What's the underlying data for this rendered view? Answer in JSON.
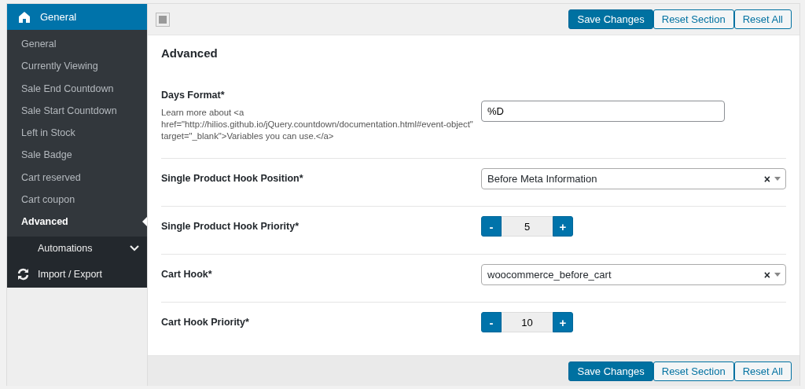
{
  "sidebar": {
    "header": {
      "label": "General"
    },
    "items": [
      {
        "label": "General",
        "selected": false
      },
      {
        "label": "Currently Viewing",
        "selected": false
      },
      {
        "label": "Sale End Countdown",
        "selected": false
      },
      {
        "label": "Sale Start Countdown",
        "selected": false
      },
      {
        "label": "Left in Stock",
        "selected": false
      },
      {
        "label": "Sale Badge",
        "selected": false
      },
      {
        "label": "Cart reserved",
        "selected": false
      },
      {
        "label": "Cart coupon",
        "selected": false
      },
      {
        "label": "Advanced",
        "selected": true
      }
    ],
    "groups": [
      {
        "kind": "collapsible",
        "label": "Automations",
        "expanded": false
      },
      {
        "kind": "link",
        "label": "Import / Export"
      }
    ]
  },
  "toolbar": {
    "buttons": [
      {
        "label": "Save Changes",
        "kind": "primary"
      },
      {
        "label": "Reset Section",
        "kind": "secondary"
      },
      {
        "label": "Reset All",
        "kind": "secondary"
      }
    ]
  },
  "section": {
    "title": "Advanced",
    "fields": [
      {
        "kind": "text",
        "label": "Days Format*",
        "description": "Learn more about <a href=\"http://hilios.github.io/jQuery.countdown/documentation.html#event-object\" target=\"_blank\">Variables you can use.</a>",
        "value": "%D"
      },
      {
        "kind": "select",
        "label": "Single Product Hook Position*",
        "value": "Before Meta Information",
        "clear": "×"
      },
      {
        "kind": "spinner",
        "label": "Single Product Hook Priority*",
        "value": "5",
        "minus": "-",
        "plus": "+"
      },
      {
        "kind": "select",
        "label": "Cart Hook*",
        "value": "woocommerce_before_cart",
        "clear": "×"
      },
      {
        "kind": "spinner",
        "label": "Cart Hook Priority*",
        "value": "10",
        "minus": "-",
        "plus": "+"
      }
    ]
  },
  "footer": {
    "buttons": [
      {
        "label": "Save Changes",
        "kind": "primary"
      },
      {
        "label": "Reset Section",
        "kind": "secondary"
      },
      {
        "label": "Reset All",
        "kind": "secondary"
      }
    ]
  }
}
